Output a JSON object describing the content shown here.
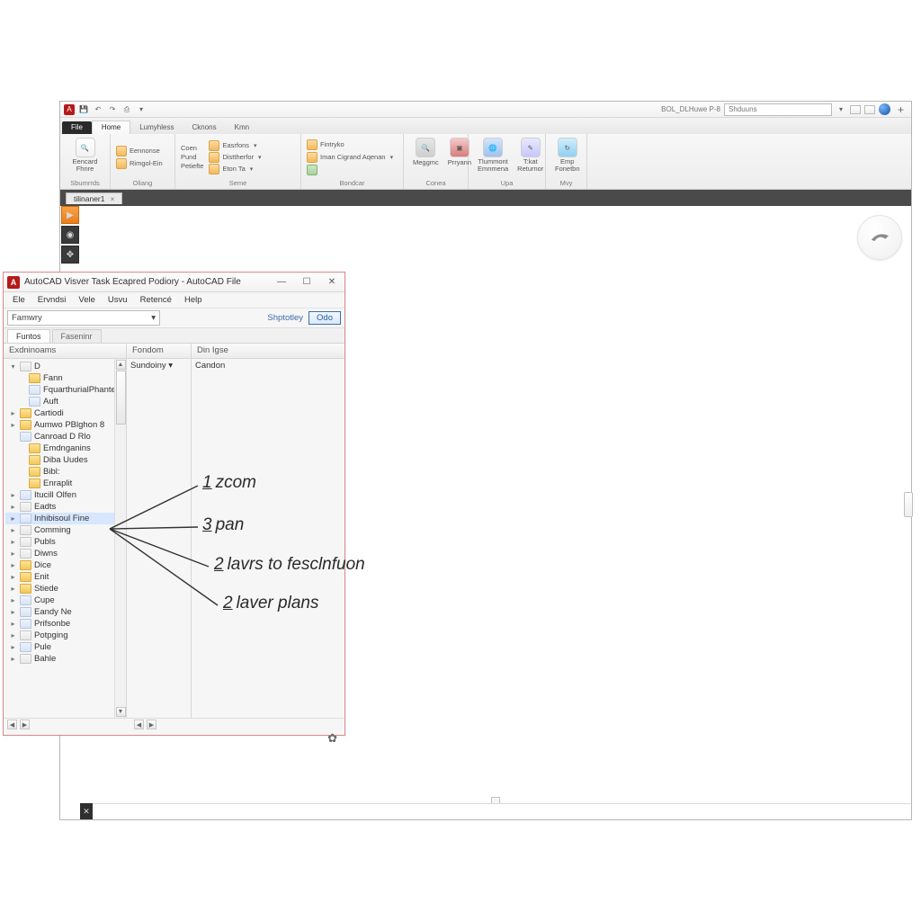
{
  "qat": {
    "right_label": "BOL_DLHuwe P-8",
    "search_placeholder": "Shduuns"
  },
  "ribbon": {
    "tabs": {
      "file": "File",
      "home": "Home",
      "lumyhless": "Lumyhless",
      "cknons": "Cknons",
      "kmn": "Kmn"
    },
    "group1": {
      "big": "Eencard\nFhnre",
      "title": "Sbumrrds"
    },
    "group2": {
      "r1": "Eennonse",
      "r2": "Rimgol-Ein",
      "title": "Oliang"
    },
    "group3": {
      "c1": "Coen",
      "c2": "Pund",
      "c3": "Petiefte",
      "r1": "Easrfons",
      "r2": "Disttherfor",
      "r3": "Eton Ta",
      "title": "Seme"
    },
    "group4": {
      "r1": "Fintryko",
      "r2": "Iman Cigrand Aqenan",
      "title": "Bondcar"
    },
    "group5": {
      "b1": "Meggmc",
      "b2": "Prryann",
      "title": "Conea"
    },
    "group6": {
      "b1": "Tlummont\nEmnmena",
      "b2": "T:kat\nReturnor",
      "title": "Upa"
    },
    "group7": {
      "b1": "Emp\nFonetbn",
      "title": "Mvy"
    }
  },
  "doctab": {
    "label": "tilinaner1"
  },
  "popup": {
    "title": "AutoCAD Visver Task Ecapred Podiory - AutoCAD File",
    "menus": [
      "Ele",
      "Ervndsi",
      "Vele",
      "Usvu",
      "Retencé",
      "Help"
    ],
    "combo": "Famwry",
    "link": "Shptotley",
    "go": "Odo",
    "tabs": [
      "Funtos",
      "Faseninr"
    ],
    "col_headers": [
      "Exdninoams",
      "Fondom",
      "Din Igse"
    ],
    "mid_row": "Sundoiny",
    "right_row": "Candon",
    "tree": [
      {
        "exp": "▾",
        "icon": "doc",
        "label": "D"
      },
      {
        "exp": "",
        "icon": "folder",
        "label": "Fann",
        "indent": 1
      },
      {
        "exp": "",
        "icon": "file",
        "label": "FquarthurialPhante",
        "indent": 1
      },
      {
        "exp": "",
        "icon": "file",
        "label": "Auft",
        "indent": 1
      },
      {
        "exp": "▸",
        "icon": "folder",
        "label": "Cartiodi"
      },
      {
        "exp": "▸",
        "icon": "folder",
        "label": "Aumwo PBlghon 8"
      },
      {
        "exp": "",
        "icon": "file",
        "label": "Canroad D Rlo"
      },
      {
        "exp": "",
        "icon": "folder",
        "label": "Emdnganins",
        "indent": 1
      },
      {
        "exp": "",
        "icon": "folder",
        "label": "Diba Uudes",
        "indent": 1
      },
      {
        "exp": "",
        "icon": "folder",
        "label": "Bibl:",
        "indent": 1
      },
      {
        "exp": "",
        "icon": "folder",
        "label": "Enraplit",
        "indent": 1
      },
      {
        "exp": "▸",
        "icon": "file",
        "label": "Itucill Olfen"
      },
      {
        "exp": "▸",
        "icon": "doc",
        "label": "Eadts"
      },
      {
        "exp": "▸",
        "icon": "file",
        "label": "Inhibisoul Fine",
        "sel": true
      },
      {
        "exp": "▸",
        "icon": "doc",
        "label": "Comming"
      },
      {
        "exp": "▸",
        "icon": "doc",
        "label": "Publs"
      },
      {
        "exp": "▸",
        "icon": "doc",
        "label": "Diwns"
      },
      {
        "exp": "▸",
        "icon": "folder",
        "label": "Dice"
      },
      {
        "exp": "▸",
        "icon": "folder",
        "label": "Enit"
      },
      {
        "exp": "▸",
        "icon": "folder",
        "label": "Stiede"
      },
      {
        "exp": "▸",
        "icon": "file",
        "label": "Cupe"
      },
      {
        "exp": "▸",
        "icon": "file",
        "label": "Eandy Ne"
      },
      {
        "exp": "▸",
        "icon": "file",
        "label": "Prifsonbe"
      },
      {
        "exp": "▸",
        "icon": "doc",
        "label": "Potpging"
      },
      {
        "exp": "▸",
        "icon": "file",
        "label": "Pule"
      },
      {
        "exp": "▸",
        "icon": "doc",
        "label": "Bahle"
      }
    ]
  },
  "annotations": {
    "a1": {
      "num": "1",
      "text": "zcom"
    },
    "a2": {
      "num": "3",
      "text": "pan"
    },
    "a3": {
      "num": "2",
      "text": "lavrs to fesclnfuon"
    },
    "a4": {
      "num": "2",
      "text": "laver plans"
    }
  }
}
